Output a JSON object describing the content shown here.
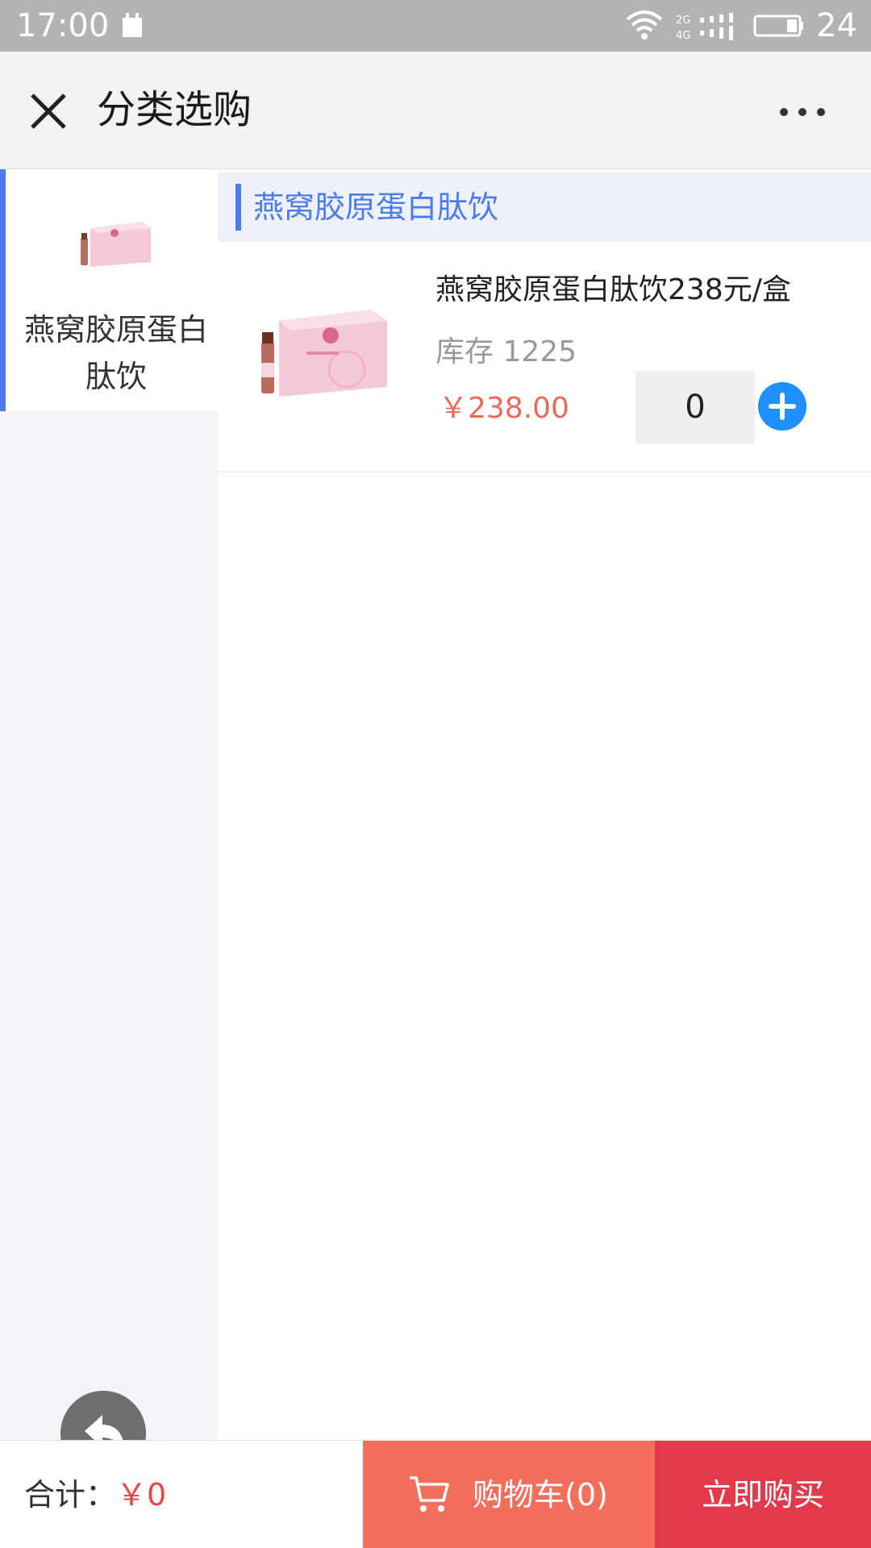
{
  "status_bar": {
    "time": "17:00",
    "battery_level": "24",
    "network": "2G 4G",
    "icons": [
      "notification-icon",
      "wifi-icon",
      "signal-icon",
      "battery-icon"
    ]
  },
  "header": {
    "title": "分类选购",
    "close_icon": "close-icon",
    "more_icon": "more-icon"
  },
  "sidebar": {
    "categories": [
      {
        "label": "燕窝胶原蛋白肽饮",
        "active": true
      }
    ]
  },
  "main": {
    "section_title": "燕窝胶原蛋白肽饮",
    "products": [
      {
        "name": "燕窝胶原蛋白肽饮238元/盒",
        "stock": "库存 1225",
        "price": "￥238.00",
        "quantity": "0"
      }
    ]
  },
  "bottom_bar": {
    "total_label": "合计：",
    "total_amount": "￥0",
    "cart_label": "购物车(0)",
    "buy_label": "立即购买"
  },
  "colors": {
    "accent": "#4b7bec",
    "price": "#e96a5b",
    "cart_button": "#f36f5c",
    "buy_button": "#e23a4a",
    "add_button": "#1e90ff"
  }
}
